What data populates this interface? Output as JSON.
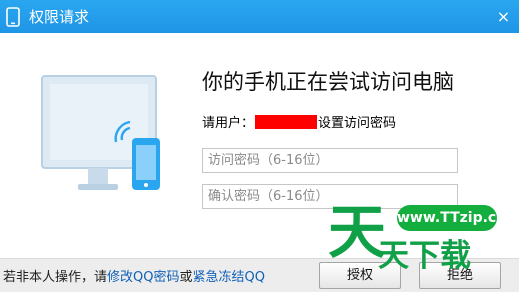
{
  "window": {
    "title": "权限请求",
    "close_glyph": "×",
    "title_icon": "phone-icon"
  },
  "main": {
    "headline": "你的手机正在尝试访问电脑",
    "user_prefix": "请用户：",
    "user_suffix": "设置访问密码",
    "password_placeholder": "访问密码（6-16位）",
    "confirm_placeholder": "确认密码（6-16位）"
  },
  "footer": {
    "text_prefix": "若非本人操作，请",
    "link_change": "修改QQ密码",
    "text_or": "或",
    "link_freeze": "紧急冻结QQ",
    "authorize_label": "授权",
    "reject_label": "拒绝"
  },
  "watermark": {
    "mark": "天",
    "badge": "www.TTzip.com",
    "text": "天下载"
  },
  "colors": {
    "title_bar": "#2aa6f0",
    "redaction": "#ff0000",
    "link": "#1060b8",
    "watermark_green": "#10a048"
  }
}
